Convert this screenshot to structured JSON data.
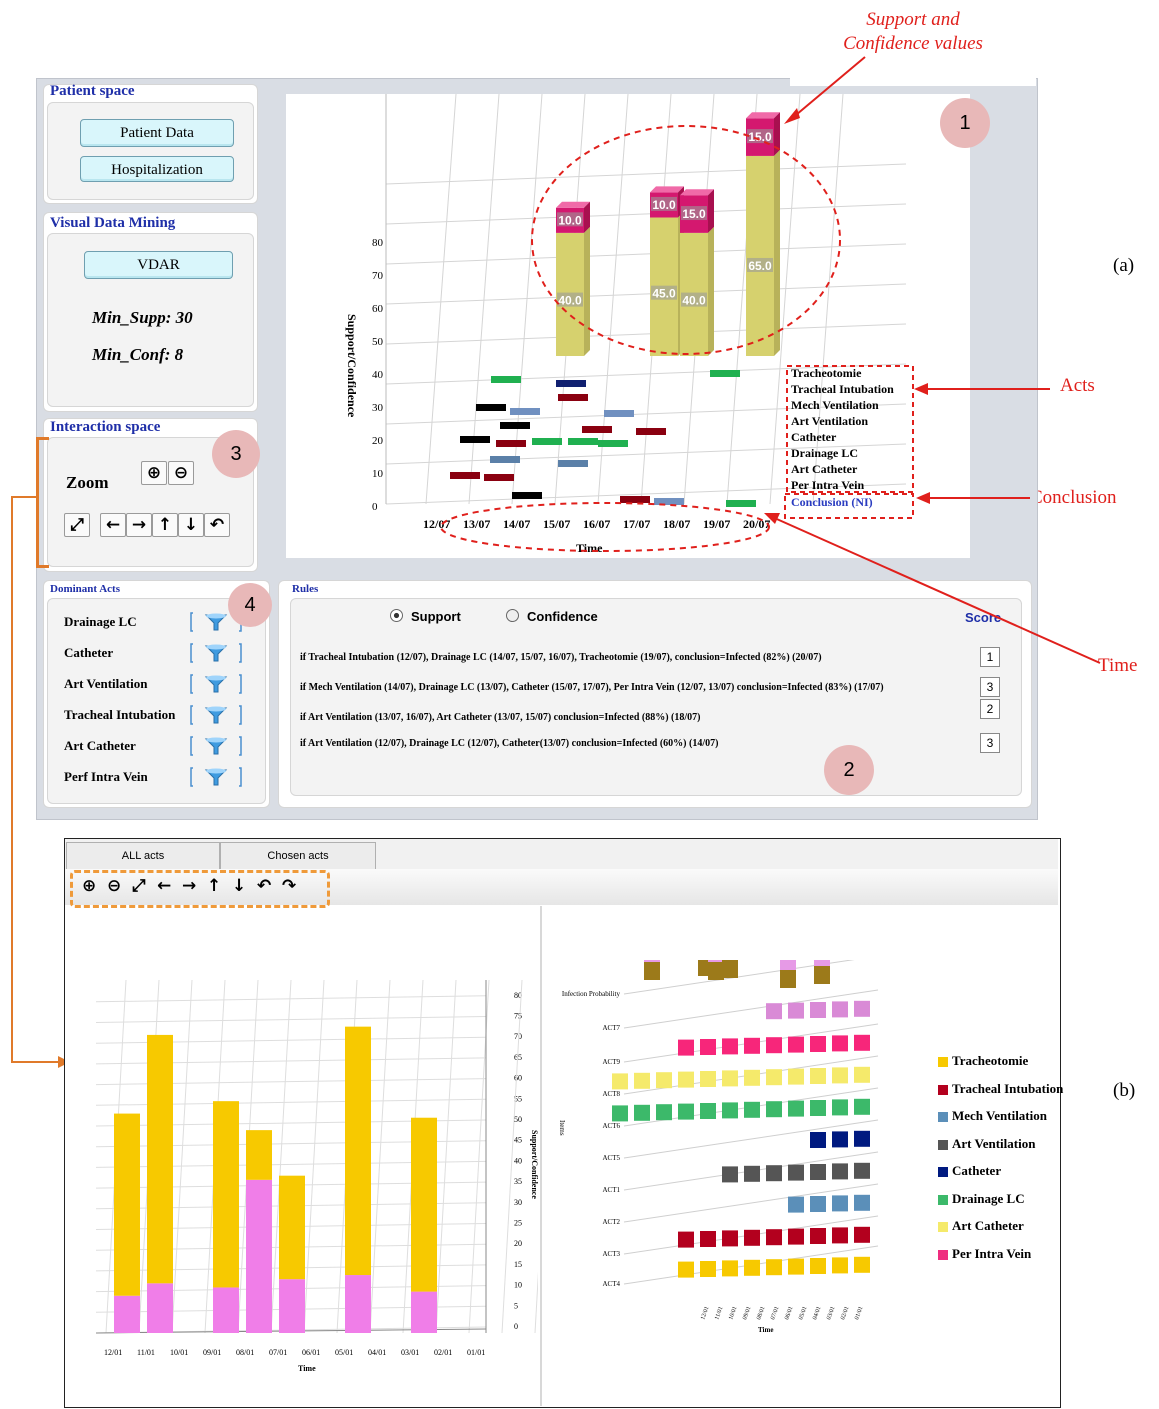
{
  "annotations": {
    "support_conf": [
      "Support and",
      "Confidence values"
    ],
    "acts": "Acts",
    "conclusion": "Conclusion",
    "time": "Time",
    "label_a": "(a)",
    "label_b": "(b)",
    "circles": [
      "1",
      "2",
      "3",
      "4"
    ]
  },
  "patient_space": {
    "title": "Patient space",
    "btn1": "Patient Data",
    "btn2": "Hospitalization"
  },
  "vdm": {
    "title": "Visual Data Mining",
    "btn": "VDAR",
    "min_supp": "Min_Supp: 30",
    "min_conf": "Min_Conf: 8"
  },
  "interaction": {
    "title": "Interaction space",
    "zoom": "Zoom",
    "icons": [
      "zoom-in-icon",
      "zoom-out-icon",
      "expand-icon",
      "arrow-left-icon",
      "arrow-right-icon",
      "arrow-up-icon",
      "arrow-down-icon",
      "undo-icon"
    ]
  },
  "dominant": {
    "title": "Dominant Acts",
    "items": [
      "Drainage LC",
      "Catheter",
      "Art Ventilation",
      "Tracheal Intubation",
      "Art Catheter",
      "Perf Intra Vein"
    ]
  },
  "rules": {
    "title": "Rules",
    "support": "Support",
    "confidence": "Confidence",
    "selected": "support",
    "score_header": "Score",
    "items": [
      {
        "text": "if Tracheal Intubation (12/07), Drainage LC (14/07, 15/07, 16/07), Tracheotomie (19/07), conclusion=Infected (82%) (20/07)",
        "score": "1"
      },
      {
        "text": "if Mech Ventilation (14/07), Drainage LC (13/07), Catheter (15/07, 17/07), Per Intra Vein (12/07, 13/07) conclusion=Infected (83%) (17/07)",
        "score": "3"
      },
      {
        "text": "if Art Ventilation (13/07, 16/07), Art Catheter (13/07, 15/07) conclusion=Infected (88%) (18/07)",
        "score": "2"
      },
      {
        "text": "if Art Ventilation (12/07), Drainage LC (12/07), Catheter(13/07) conclusion=Infected (60%) (14/07)",
        "score": "3"
      }
    ]
  },
  "chart_data": [
    {
      "type": "bar",
      "xlabel": "Time",
      "ylabel": "Support/Confidence",
      "categories": [
        "12/07",
        "13/07",
        "14/07",
        "15/07",
        "16/07",
        "17/07",
        "18/07",
        "19/07",
        "20/07"
      ],
      "yticks": [
        "0",
        "10",
        "20",
        "30",
        "40",
        "50",
        "60",
        "70",
        "80"
      ],
      "ylim": [
        0,
        80
      ],
      "legend": [
        "Tracheotomie",
        "Tracheal Intubation",
        "Mech Ventilation",
        "Art Ventilation",
        "Catheter",
        "Drainage LC",
        "Art Catheter",
        "Per Intra Vein",
        "Conclusion (NI)"
      ],
      "bars": [
        {
          "x": "14/07",
          "support": 40.0,
          "confidence": 10.0
        },
        {
          "x": "17/07",
          "support": 45.0,
          "confidence": 10.0
        },
        {
          "x": "18/07",
          "support": 40.0,
          "confidence": 15.0
        },
        {
          "x": "20/07",
          "support": 65.0,
          "confidence": 15.0
        }
      ],
      "colors": {
        "support": "#d6d16e",
        "confidence": "#d4186f"
      }
    },
    {
      "type": "bar",
      "xlabel": "Time",
      "ylabel": "Support/Confidence",
      "categories": [
        "12/01",
        "11/01",
        "10/01",
        "09/01",
        "08/01",
        "07/01",
        "06/01",
        "05/01",
        "04/01",
        "03/01",
        "02/01",
        "01/01"
      ],
      "yticks": [
        "0",
        "5",
        "10",
        "15",
        "20",
        "25",
        "30",
        "35",
        "40",
        "45",
        "50",
        "55",
        "60",
        "65",
        "70",
        "75",
        "80"
      ],
      "ylim": [
        0,
        80
      ],
      "series": [
        {
          "values": [
            9,
            12,
            0,
            11,
            37,
            13,
            0,
            14,
            0,
            10,
            0,
            0
          ]
        },
        {
          "values": [
            44,
            60,
            0,
            45,
            12,
            25,
            0,
            60,
            0,
            42,
            0,
            0
          ]
        }
      ],
      "colors": [
        "#f07ee8",
        "#f7c900"
      ]
    },
    {
      "type": "heatmap",
      "xlabel": "Time",
      "ylabel": "Items",
      "x": [
        "12/01",
        "11/01",
        "10/01",
        "09/01",
        "08/01",
        "07/01",
        "06/01",
        "05/01",
        "04/01",
        "03/01",
        "02/01",
        "01/01"
      ],
      "rows": [
        "Infection Probability",
        "ACT7",
        "ACT9",
        "ACT8",
        "ACT6",
        "ACT5",
        "ACT1",
        "ACT2",
        "ACT3",
        "ACT4"
      ],
      "legend": [
        "Tracheotomie",
        "Tracheal Intubation",
        "Mech Ventilation",
        "Art Ventilation",
        "Catheter",
        "Drainage LC",
        "Art Catheter",
        "Per Intra Vein"
      ],
      "legend_colors": [
        "#f7c900",
        "#b3001e",
        "#5b8fb9",
        "#555555",
        "#001a80",
        "#3cb96a",
        "#f5ea6b",
        "#ef2d7f"
      ]
    }
  ],
  "bottom": {
    "tab_all": "ALL acts",
    "tab_chosen": "Chosen acts",
    "toolbar": [
      "zoom-in-icon",
      "zoom-out-icon",
      "expand-icon",
      "arrow-left-icon",
      "arrow-right-icon",
      "arrow-up-icon",
      "arrow-down-icon",
      "undo-icon",
      "redo-icon"
    ]
  }
}
